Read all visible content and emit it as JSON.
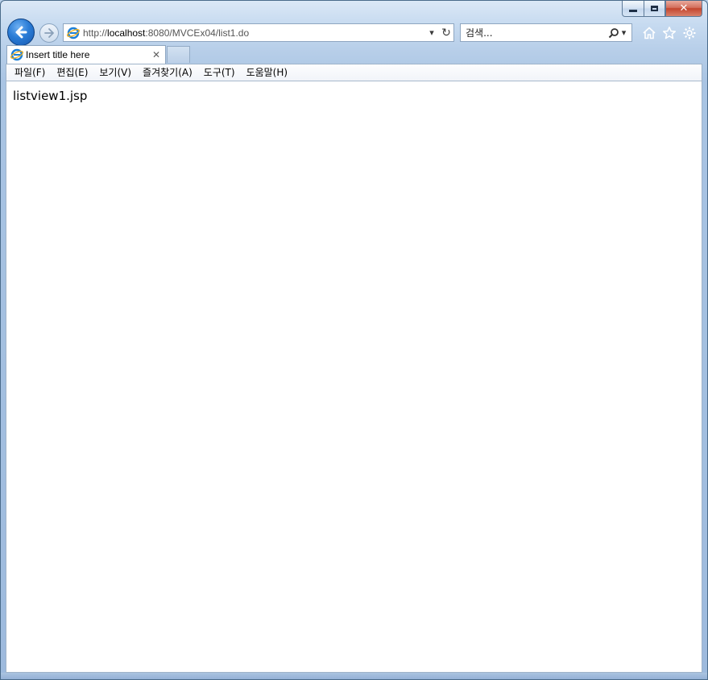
{
  "window": {
    "caption": {
      "close_glyph": "✕"
    }
  },
  "nav": {
    "url_prefix": "http://",
    "url_host": "localhost",
    "url_rest": ":8080/MVCEx04/list1.do",
    "search_placeholder": "검색...",
    "dropdown_glyph": "▾",
    "refresh_glyph": "↻",
    "search_dropdown_glyph": "▾"
  },
  "tabs": [
    {
      "title": "Insert title here",
      "close_glyph": "✕"
    }
  ],
  "menu": {
    "items": [
      {
        "label": "파일(F)"
      },
      {
        "label": "편집(E)"
      },
      {
        "label": "보기(V)"
      },
      {
        "label": "즐겨찾기(A)"
      },
      {
        "label": "도구(T)"
      },
      {
        "label": "도움말(H)"
      }
    ]
  },
  "page": {
    "body_text": "listview1.jsp"
  },
  "colors": {
    "accent": "#2a7cd6",
    "close_red": "#c4462e",
    "frame": "#b8cfe9"
  },
  "icons": {
    "back": "back-arrow-icon",
    "forward": "forward-arrow-icon",
    "ie": "internet-explorer-icon",
    "search": "search-icon",
    "home": "home-icon",
    "favorites": "star-icon",
    "tools": "gear-icon"
  }
}
